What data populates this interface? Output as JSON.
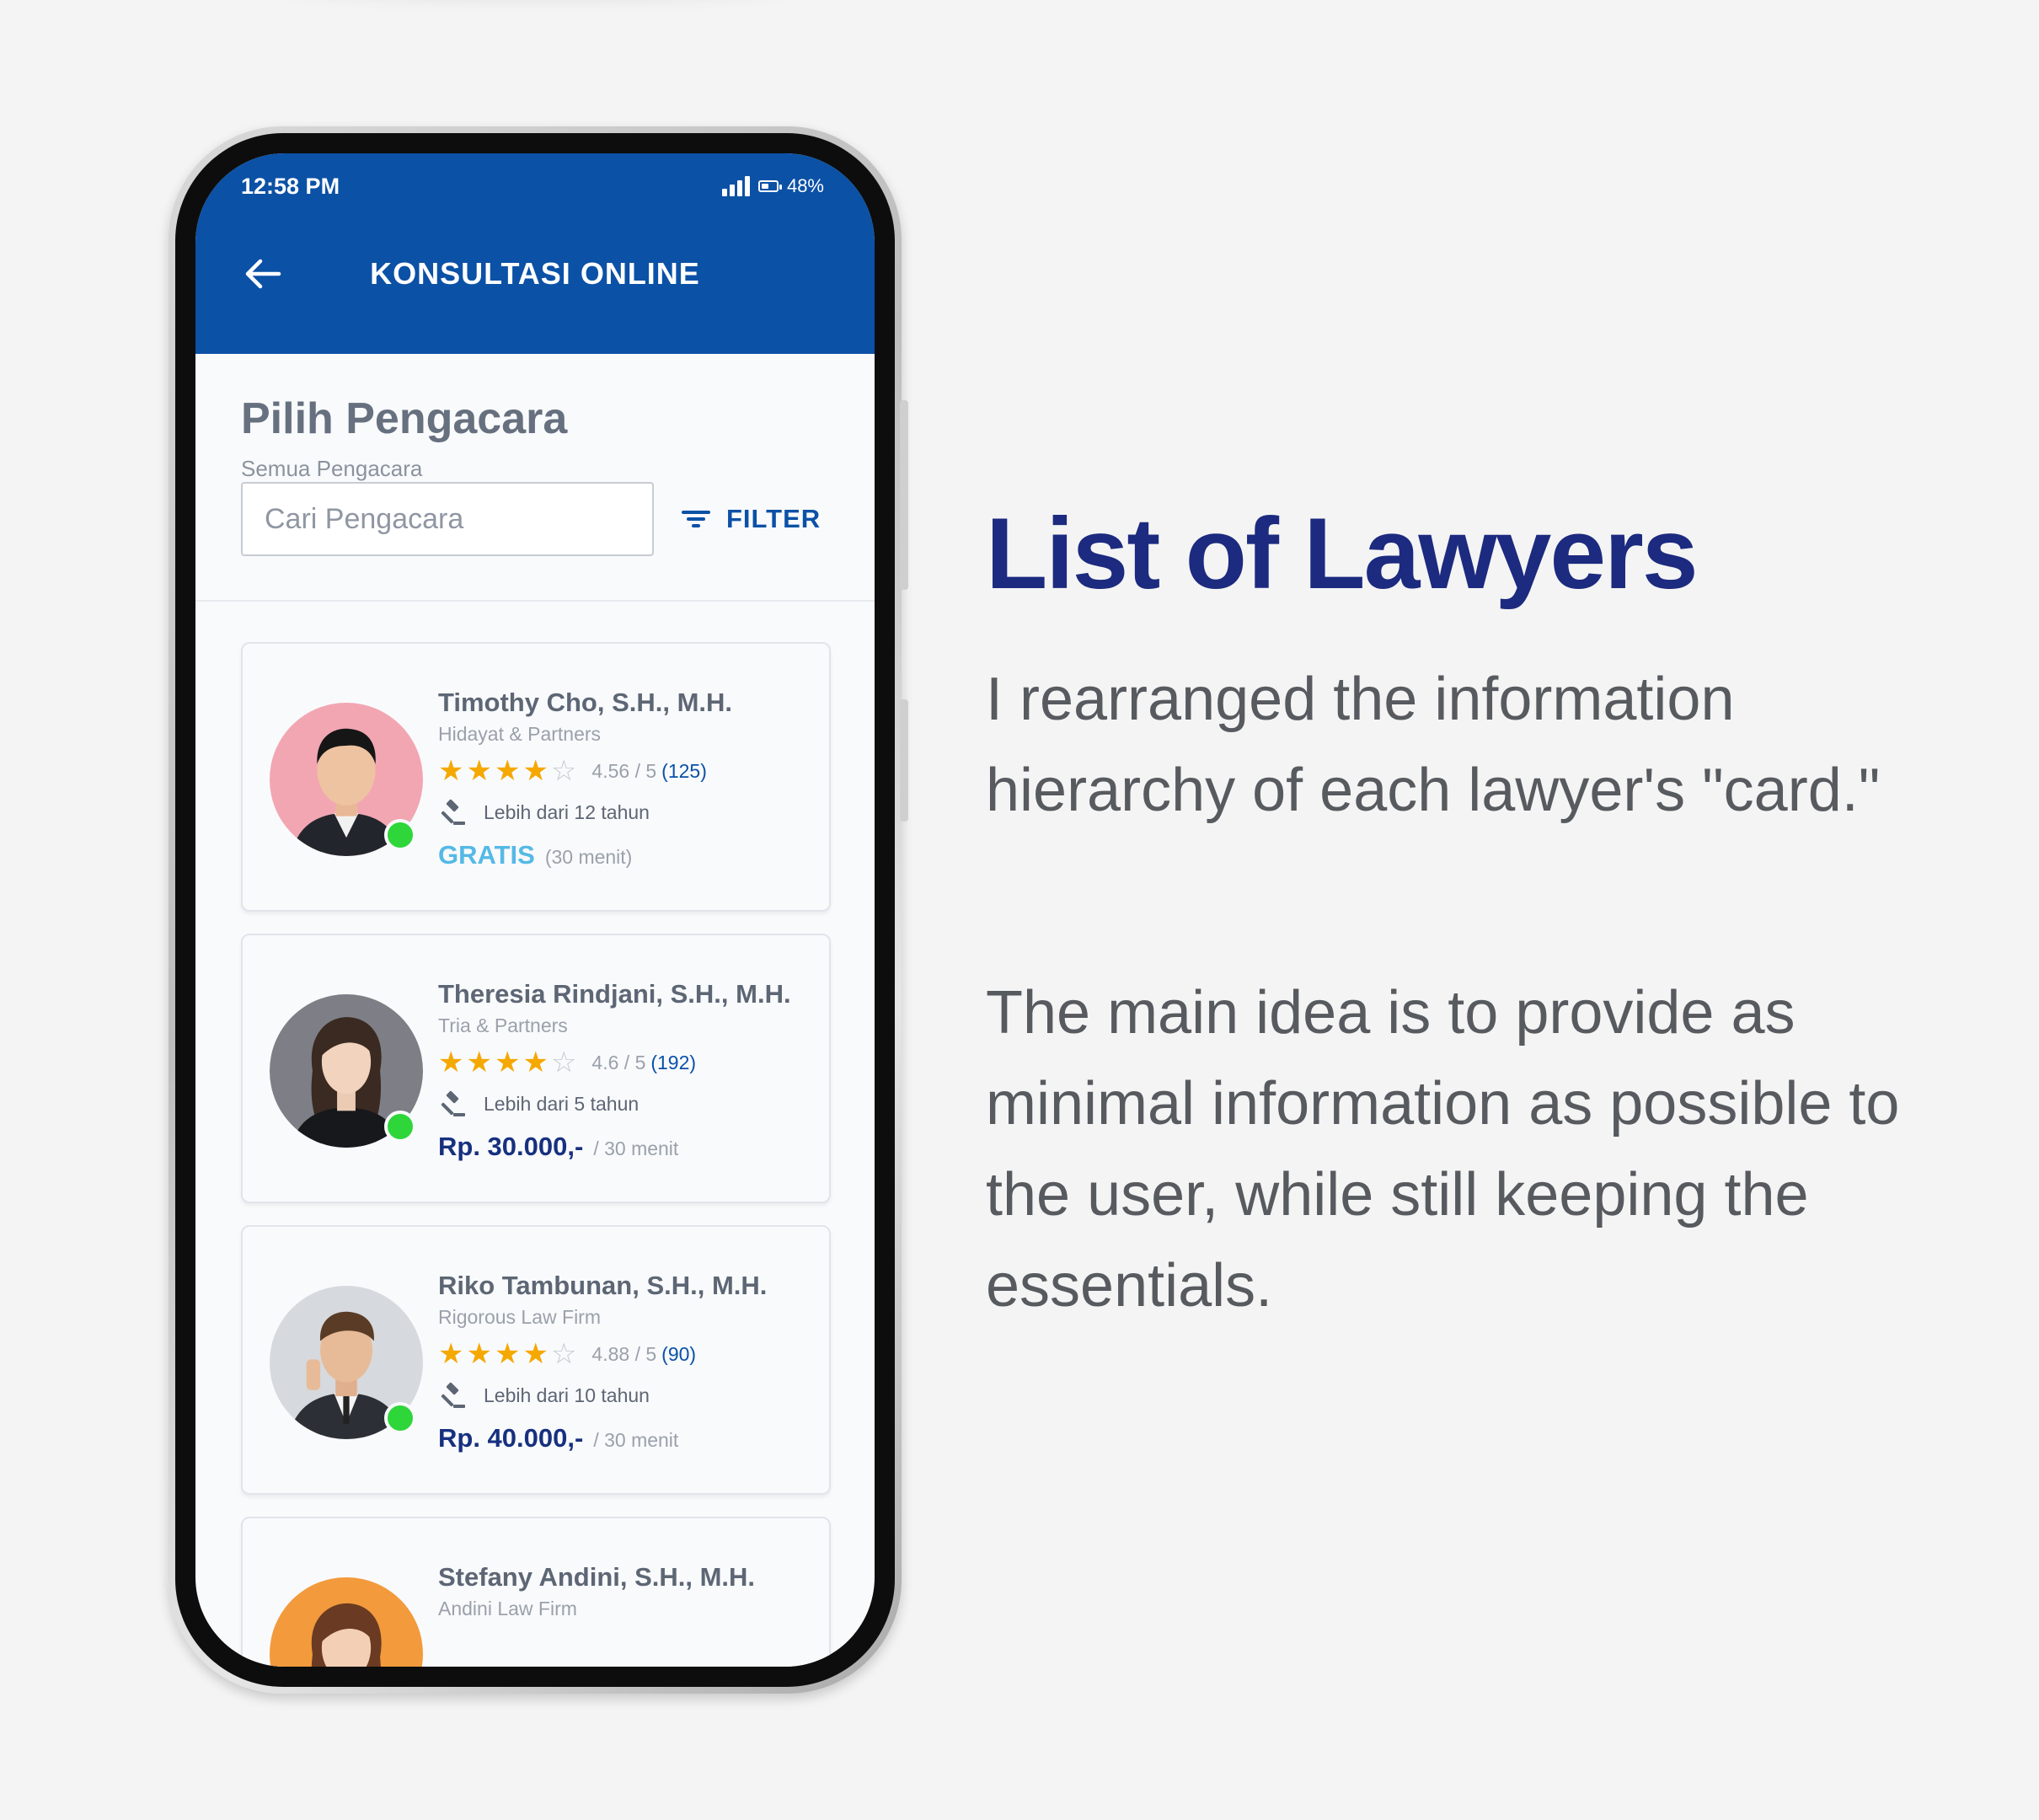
{
  "status_bar": {
    "time": "12:58 PM",
    "battery": "48%"
  },
  "app_bar": {
    "title": "KONSULTASI ONLINE"
  },
  "page": {
    "title": "Pilih Pengacara",
    "subtitle": "Semua Pengacara"
  },
  "search": {
    "placeholder": "Cari Pengacara",
    "filter_label": "FILTER"
  },
  "lawyers": [
    {
      "name": "Timothy Cho, S.H., M.H.",
      "firm": "Hidayat & Partners",
      "stars": 4,
      "score": "4.56 / 5",
      "reviews": "(125)",
      "experience": "Lebih dari 12 tahun",
      "price": "GRATIS",
      "duration": "(30 menit)",
      "online": true,
      "avatar_bg": "#f2a6b2"
    },
    {
      "name": "Theresia Rindjani, S.H., M.H.",
      "firm": "Tria & Partners",
      "stars": 4,
      "score": "4.6 / 5",
      "reviews": "(192)",
      "experience": "Lebih dari 5 tahun",
      "price": "Rp. 30.000,-",
      "duration": "/ 30 menit",
      "online": true,
      "avatar_bg": "#7e7e86"
    },
    {
      "name": "Riko Tambunan, S.H., M.H.",
      "firm": "Rigorous Law Firm",
      "stars": 4,
      "score": "4.88 / 5",
      "reviews": "(90)",
      "experience": "Lebih dari 10 tahun",
      "price": "Rp. 40.000,-",
      "duration": "/ 30 menit",
      "online": true,
      "avatar_bg": "#d6d9dd"
    },
    {
      "name": "Stefany Andini, S.H., M.H.",
      "firm": "Andini Law Firm",
      "avatar_bg": "#f39a3c"
    }
  ],
  "headline": "List of Lawyers",
  "paragraphs": [
    "I rearranged the information hierarchy of each lawyer's \"card.\"",
    "The main idea is to provide as minimal information as possible to the user, while still keeping the essentials."
  ],
  "colors": {
    "app_bar": "#0b51a6",
    "headline": "#1c2a7f",
    "star": "#f5a800",
    "online": "#2ed63a",
    "free_price": "#55b9e6",
    "price": "#17307f"
  }
}
